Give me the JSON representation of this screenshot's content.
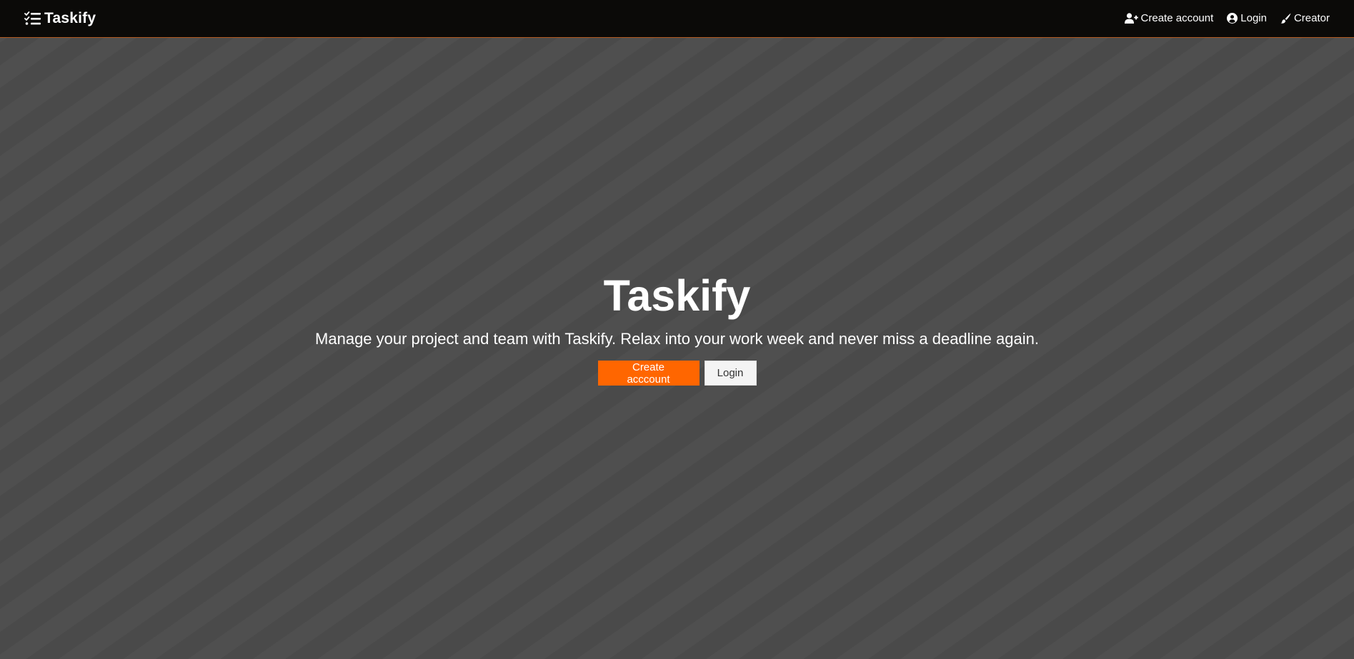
{
  "navbar": {
    "brand": {
      "name": "Taskify",
      "icon": "tasks-list-icon"
    },
    "links": [
      {
        "label": "Create account",
        "icon": "user-plus-icon"
      },
      {
        "label": "Login",
        "icon": "user-circle-icon"
      },
      {
        "label": "Creator",
        "icon": "paint-brush-icon"
      }
    ]
  },
  "hero": {
    "title": "Taskify",
    "tagline": "Manage your project and team with Taskify. Relax into your work week and never miss a deadline again.",
    "primary_button": "Create acccount",
    "secondary_button": "Login"
  },
  "colors": {
    "navbar_bg": "#0b0a08",
    "navbar_border": "#b35a1f",
    "page_bg": "#4b4b4b",
    "accent": "#ff6600",
    "secondary_button_bg": "#f4f4f4"
  }
}
